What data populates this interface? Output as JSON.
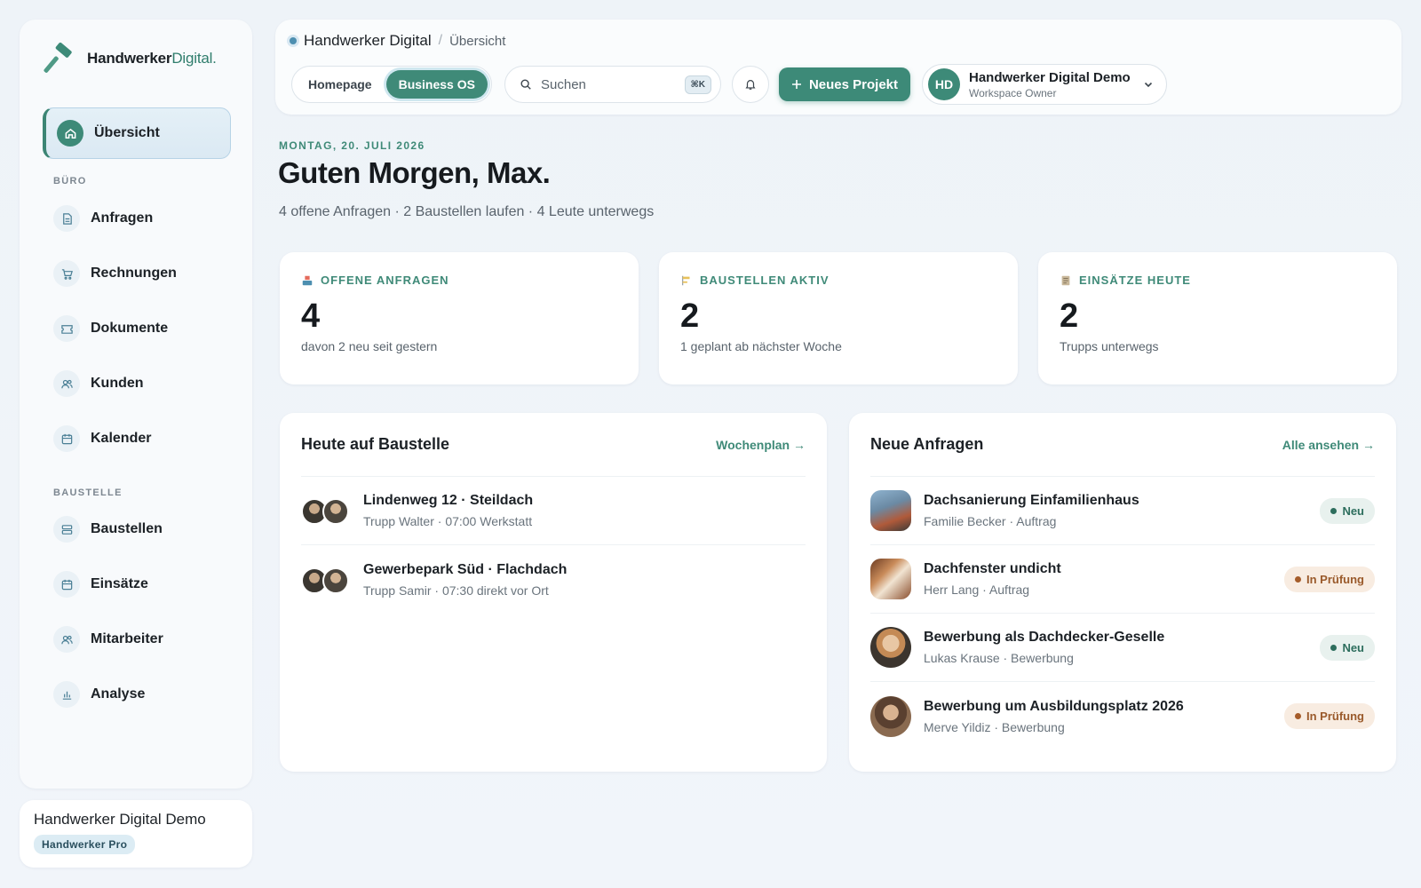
{
  "brand": {
    "name_bold": "Handwerker",
    "name_accent": "Digital."
  },
  "sidebar": {
    "active": {
      "label": "Übersicht",
      "icon": "home-icon"
    },
    "section_office": "BÜRO",
    "office_items": [
      {
        "label": "Anfragen",
        "icon": "document-icon"
      },
      {
        "label": "Rechnungen",
        "icon": "cart-icon"
      },
      {
        "label": "Dokumente",
        "icon": "ticket-icon"
      },
      {
        "label": "Kunden",
        "icon": "users-icon"
      },
      {
        "label": "Kalender",
        "icon": "calendar-icon"
      }
    ],
    "section_site": "BAUSTELLE",
    "site_items": [
      {
        "label": "Baustellen",
        "icon": "server-icon"
      },
      {
        "label": "Einsätze",
        "icon": "calendar-icon"
      },
      {
        "label": "Mitarbeiter",
        "icon": "users-icon"
      },
      {
        "label": "Analyse",
        "icon": "bar-chart-icon"
      }
    ]
  },
  "account": {
    "name": "Handwerker Digital Demo",
    "plan": "Handwerker Pro"
  },
  "topbar": {
    "breadcrumb_root": "Handwerker Digital",
    "breadcrumb_sep": "/",
    "breadcrumb_current": "Übersicht",
    "segment_homepage": "Homepage",
    "segment_business": "Business OS",
    "search_placeholder": "Suchen",
    "search_shortcut": "⌘K",
    "new_project": "Neues Projekt",
    "user_initials": "HD",
    "user_name": "Handwerker Digital Demo",
    "user_role": "Workspace Owner"
  },
  "hero": {
    "date": "MONTAG, 20. JULI 2026",
    "greeting": "Guten Morgen, Max.",
    "summary": "4 offene Anfragen · 2 Baustellen laufen · 4 Leute unterwegs"
  },
  "stats": [
    {
      "label": "OFFENE ANFRAGEN",
      "value": "4",
      "sub": "davon 2 neu seit gestern",
      "icon": "inbox-icon"
    },
    {
      "label": "BAUSTELLEN AKTIV",
      "value": "2",
      "sub": "1 geplant ab nächster Woche",
      "icon": "construction-icon"
    },
    {
      "label": "EINSÄTZE HEUTE",
      "value": "2",
      "sub": "Trupps unterwegs",
      "icon": "notebook-icon"
    }
  ],
  "today_panel": {
    "title": "Heute auf Baustelle",
    "link": "Wochenplan →",
    "rows": [
      {
        "title": "Lindenweg 12 · Steildach",
        "sub": "Trupp Walter · 07:00 Werkstatt"
      },
      {
        "title": "Gewerbepark Süd · Flachdach",
        "sub": "Trupp Samir · 07:30 direkt vor Ort"
      }
    ]
  },
  "requests_panel": {
    "title": "Neue Anfragen",
    "link": "Alle ansehen →",
    "rows": [
      {
        "title": "Dachsanierung Einfamilienhaus",
        "sub": "Familie Becker · Auftrag",
        "status": "Neu",
        "status_kind": "neu"
      },
      {
        "title": "Dachfenster undicht",
        "sub": "Herr Lang · Auftrag",
        "status": "In Prüfung",
        "status_kind": "pruef"
      },
      {
        "title": "Bewerbung als Dachdecker-Geselle",
        "sub": "Lukas Krause · Bewerbung",
        "status": "Neu",
        "status_kind": "neu"
      },
      {
        "title": "Bewerbung um Ausbildungsplatz 2026",
        "sub": "Merve Yildiz · Bewerbung",
        "status": "In Prüfung",
        "status_kind": "pruef"
      }
    ]
  },
  "colors": {
    "accent": "#3d8a78",
    "accent_text": "#3f8a78",
    "neu": "#2d6e5d",
    "pruef": "#9a5a2b"
  }
}
